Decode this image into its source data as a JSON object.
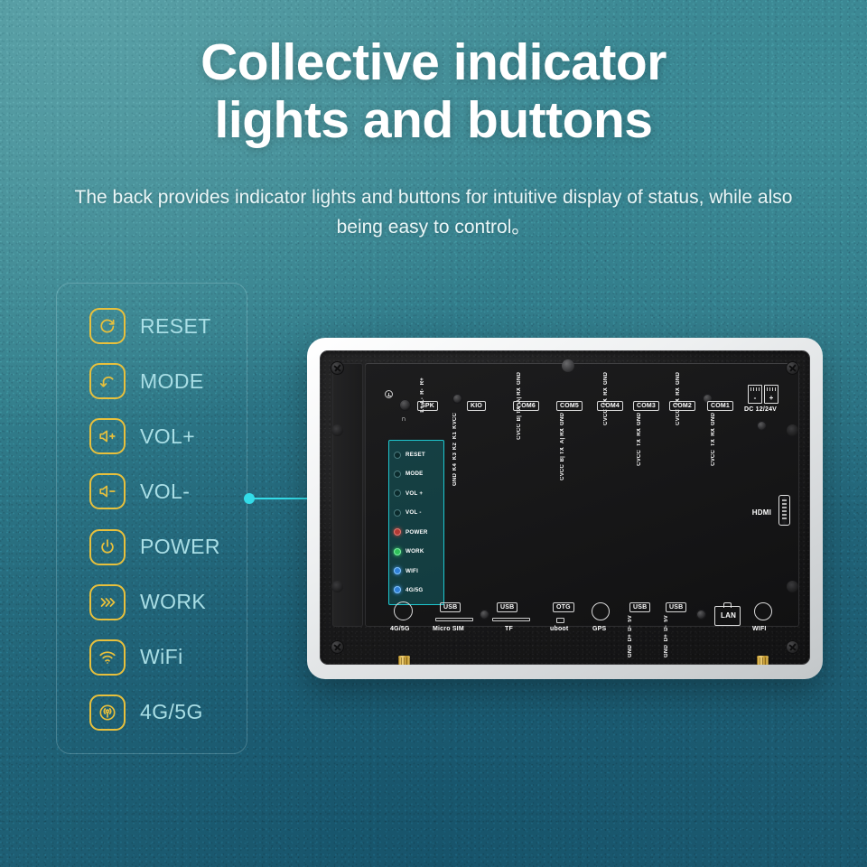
{
  "theme": {
    "bg_top_left": "#5aa0a6",
    "bg_bottom_right": "#1d5a70",
    "accent_cyan": "#33dce8",
    "icon_yellow": "#e8c03c",
    "label_cyan": "#a9dee5",
    "strip_border": "#1ec7cf"
  },
  "headline": {
    "line1": "Collective indicator",
    "line2": "lights and buttons"
  },
  "subhead": "The back provides indicator lights and buttons for intuitive display of status, while also being easy to control。",
  "legend": {
    "items": [
      {
        "icon": "reset-icon",
        "label": "RESET"
      },
      {
        "icon": "mode-icon",
        "label": "MODE"
      },
      {
        "icon": "volup-icon",
        "label": "VOL+"
      },
      {
        "icon": "voldown-icon",
        "label": "VOL-"
      },
      {
        "icon": "power-icon",
        "label": "POWER"
      },
      {
        "icon": "work-icon",
        "label": "WORK"
      },
      {
        "icon": "wifi-icon",
        "label": "WiFi"
      },
      {
        "icon": "cellular-icon",
        "label": "4G/5G"
      }
    ]
  },
  "device": {
    "indicator_strip": [
      {
        "label": "RESET",
        "led": "off"
      },
      {
        "label": "MODE",
        "led": "off"
      },
      {
        "label": "VOL +",
        "led": "off"
      },
      {
        "label": "VOL -",
        "led": "off"
      },
      {
        "label": "POWER",
        "led": "red"
      },
      {
        "label": "WORK",
        "led": "green"
      },
      {
        "label": "WIFI",
        "led": "blue"
      },
      {
        "label": "4G/5G",
        "led": "blue"
      }
    ],
    "top_ports": {
      "headphone_symbol": "∩",
      "spk": {
        "name": "SPK",
        "pins_top": [
          "R+",
          "R-",
          "L-",
          "L+"
        ]
      },
      "kio": {
        "name": "KIO",
        "pins_bottom": [
          "KVCC",
          "K1",
          "K2",
          "K3",
          "K4",
          "GND"
        ]
      },
      "com6": {
        "name": "COM6",
        "pins_top": [
          "GND",
          "A| RX",
          "B| TX",
          "CVCC"
        ]
      },
      "com5": {
        "name": "COM5",
        "pins_bottom": [
          "GND",
          "A| RX",
          "B| TX",
          "CVCC"
        ]
      },
      "com4": {
        "name": "COM4",
        "pins_top": [
          "GND",
          "RX",
          "TX",
          "CVCC"
        ]
      },
      "com3": {
        "name": "COM3",
        "pins_bottom": [
          "GND",
          "RX",
          "TX",
          "CVCC"
        ]
      },
      "com2": {
        "name": "COM2",
        "pins_top": [
          "GND",
          "RX",
          "TX",
          "CVCC"
        ]
      },
      "com1": {
        "name": "COM1",
        "pins_bottom": [
          "GND",
          "RX",
          "TX",
          "CVCC"
        ]
      },
      "dc": {
        "label": "DC 12/24V",
        "minus": "-",
        "plus": "+"
      }
    },
    "side_ports": {
      "hdmi": "HDMI"
    },
    "bottom_ports": [
      {
        "name": "4G/5G",
        "type": "antenna"
      },
      {
        "name": "USB",
        "type": "badge",
        "sub": "Micro SIM"
      },
      {
        "name": "USB",
        "type": "badge",
        "sub": "TF"
      },
      {
        "name": "OTG",
        "type": "badge",
        "sub": "uboot"
      },
      {
        "name": "GPS",
        "type": "antenna"
      },
      {
        "name": "USB",
        "type": "badge",
        "pins": [
          "5V",
          "D-",
          "D+",
          "GND"
        ]
      },
      {
        "name": "USB",
        "type": "badge",
        "pins": [
          "5V",
          "D-",
          "D+",
          "GND"
        ]
      },
      {
        "name": "LAN",
        "type": "rj45"
      },
      {
        "name": "WIFI",
        "type": "antenna"
      }
    ]
  }
}
